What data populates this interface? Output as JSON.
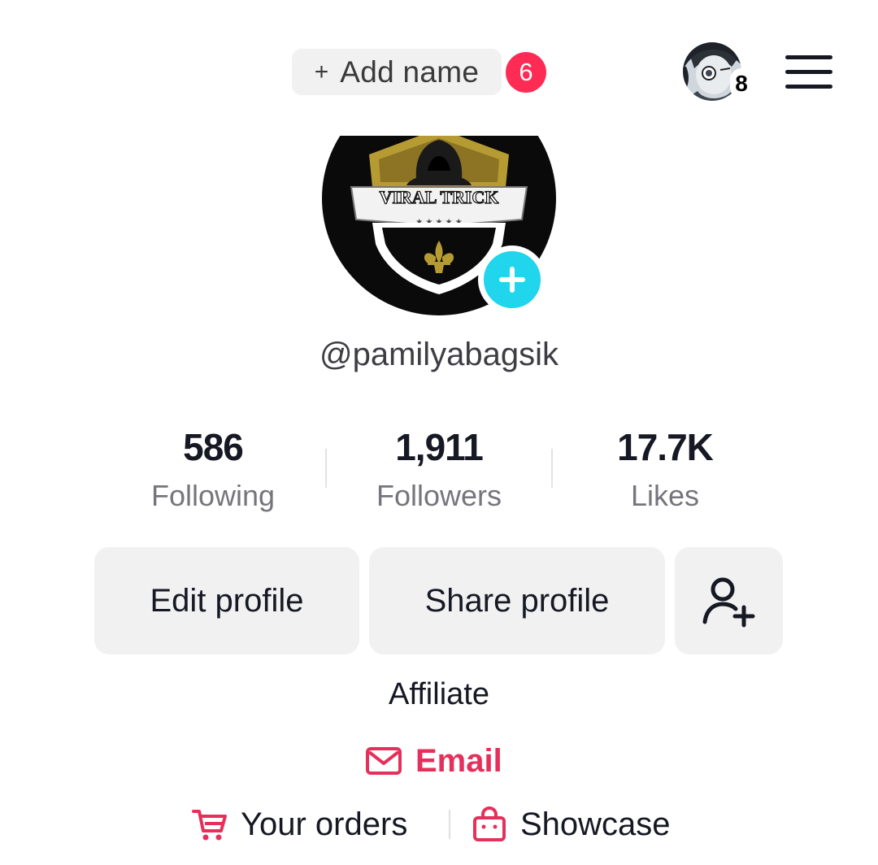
{
  "header": {
    "add_name_label": "Add name",
    "add_name_icon": "plus-icon",
    "notification_count": "6",
    "account_switch_count": "8",
    "menu_icon": "hamburger-menu-icon"
  },
  "profile": {
    "avatar_logo_text": "VIRAL TRICK",
    "username": "@pamilyabagsik"
  },
  "stats": [
    {
      "value": "586",
      "label": "Following"
    },
    {
      "value": "1,911",
      "label": "Followers"
    },
    {
      "value": "17.7K",
      "label": "Likes"
    }
  ],
  "actions": {
    "edit_profile": "Edit profile",
    "share_profile": "Share profile",
    "add_friend_icon": "add-friend-icon"
  },
  "bio": {
    "text": "Affiliate",
    "email_label": "Email",
    "orders_label": "Your orders",
    "showcase_label": "Showcase"
  },
  "colors": {
    "badge": "#fe2c55",
    "add_photo": "#20d5ec",
    "email": "#e5305b",
    "button_bg": "#f1f1f2"
  }
}
